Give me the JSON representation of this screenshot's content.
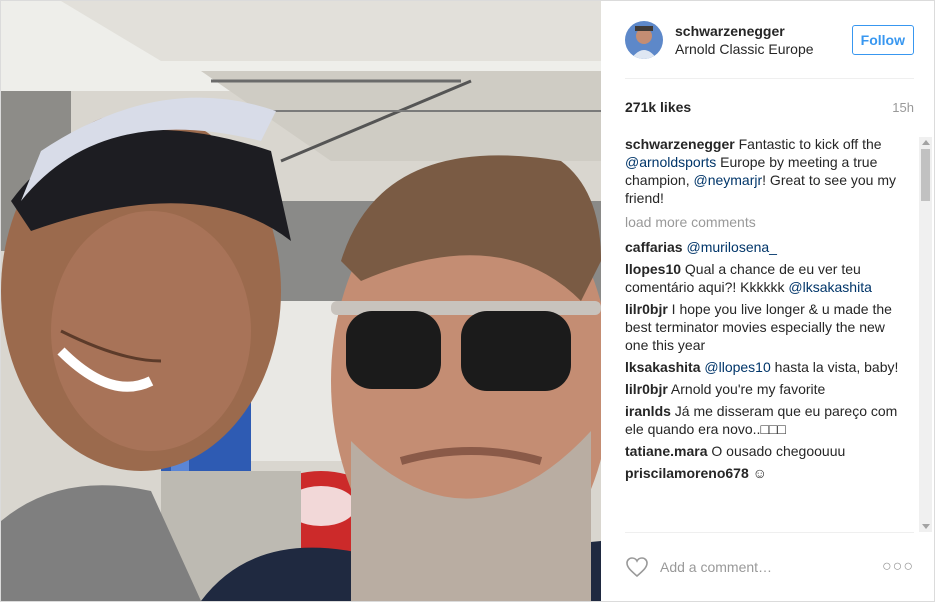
{
  "post": {
    "username": "schwarzenegger",
    "location": "Arnold Classic Europe",
    "follow_label": "Follow",
    "likes": "271k likes",
    "time": "15h"
  },
  "caption": {
    "user": "schwarzenegger",
    "t1": " Fantastic to kick off the ",
    "m1": "@arnoldsports",
    "t2": " Europe by meeting a true champion, ",
    "m2": "@neymarjr",
    "t3": "! Great to see you my friend!"
  },
  "load_more": "load more comments",
  "comments": [
    {
      "user": "caffarias",
      "t1": " ",
      "m1": "@murilosena_",
      "t2": ""
    },
    {
      "user": "llopes10",
      "t1": " Qual a chance de eu ver teu comentário aqui?! Kkkkkk ",
      "m1": "@lksakashita",
      "t2": ""
    },
    {
      "user": "lilr0bjr",
      "t1": " I hope you live longer & u made the best terminator movies especially the new one this year",
      "m1": "",
      "t2": ""
    },
    {
      "user": "lksakashita",
      "t1": " ",
      "m1": "@llopes10",
      "t2": " hasta la vista, baby!"
    },
    {
      "user": "lilr0bjr",
      "t1": " Arnold you're my favorite",
      "m1": "",
      "t2": ""
    },
    {
      "user": "iranlds",
      "t1": " Já me disseram que eu pareço com ele quando era novo..□□□",
      "m1": "",
      "t2": ""
    },
    {
      "user": "tatiane.mara",
      "t1": " O ousado chegoouuu",
      "m1": "",
      "t2": ""
    },
    {
      "user": "priscilamoreno678",
      "t1": " ☺",
      "m1": "",
      "t2": ""
    }
  ],
  "footer": {
    "placeholder": "Add a comment…",
    "more_glyph": "○○○",
    "heart_icon": "heart-outline-icon"
  },
  "colors": {
    "accent": "#3897f0",
    "mention": "#003569",
    "muted": "#999999"
  }
}
